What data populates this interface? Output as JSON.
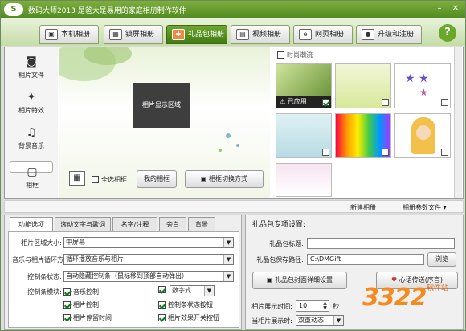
{
  "title": "数码大师2013  是爸大是易用的家庭相册制作软件",
  "tabs": [
    {
      "label": "本机相册",
      "icon": "photo-album-icon"
    },
    {
      "label": "锁屏相册",
      "icon": "lock-screen-icon"
    },
    {
      "label": "礼品包相册",
      "icon": "gift-icon"
    },
    {
      "label": "视频相册",
      "icon": "film-icon"
    },
    {
      "label": "网页相册",
      "icon": "web-icon"
    },
    {
      "label": "升级和注册",
      "icon": "upgrade-icon"
    }
  ],
  "active_tab": "礼品包相册",
  "help_label": "?",
  "left_nav": [
    {
      "label": "相片文件",
      "icon": "camera-icon"
    },
    {
      "label": "相片特效",
      "icon": "sparkle-icon"
    },
    {
      "label": "背景音乐",
      "icon": "music-icon"
    },
    {
      "label": "相框",
      "icon": "frame-icon"
    }
  ],
  "preview_label": "相片显示区域",
  "select_all_frames": "全选相框",
  "my_frames_button": "我的相框",
  "frame_switch_button": "相框切换方式",
  "gallery": {
    "category": "时尚潮流",
    "applied_label": "已应用"
  },
  "strip": {
    "new_album": "新建相册",
    "album_params": "相册参数文件"
  },
  "lower_tabs": [
    "功能选项",
    "滚动文字与歌词",
    "名字/注释",
    "旁白",
    "背景"
  ],
  "options": {
    "photo_area_label": "相片区域大小:",
    "photo_area_value": "中屏幕",
    "music_loop_label": "音乐与相片循环方案:",
    "music_loop_value": "循环播放音乐与相片",
    "control_bar_label": "控制条状态:",
    "control_bar_value": "自动隐藏控制条（鼠标移到顶部自动弹出）",
    "control_modules_label": "控制条模块:",
    "music_control": "音乐控制",
    "digital_style": "数字式",
    "photo_control": "相片控制",
    "control_bar_buttons": "控制条状态按钮",
    "photo_pause_time": "相片停留时间",
    "photo_effect_switch": "相片效果开关按钮"
  },
  "gift_settings": {
    "title": "礼品包专项设置:",
    "gift_title_label": "礼品包标题:",
    "gift_title_value": "",
    "save_path_label": "礼品包保存路径:",
    "save_path_value": "C:\\DMGift",
    "browse_button": "浏览",
    "cover_button": "礼品包封面详细设置",
    "message_button": "心语传送(序言)",
    "display_time_label": "相片展示时间:",
    "display_time_value": "10",
    "display_time_unit": "秒",
    "display_mode_label": "当相片展示时:",
    "display_mode_value": "双重动态"
  },
  "watermark": {
    "number": "3322",
    "site": "软件站"
  }
}
